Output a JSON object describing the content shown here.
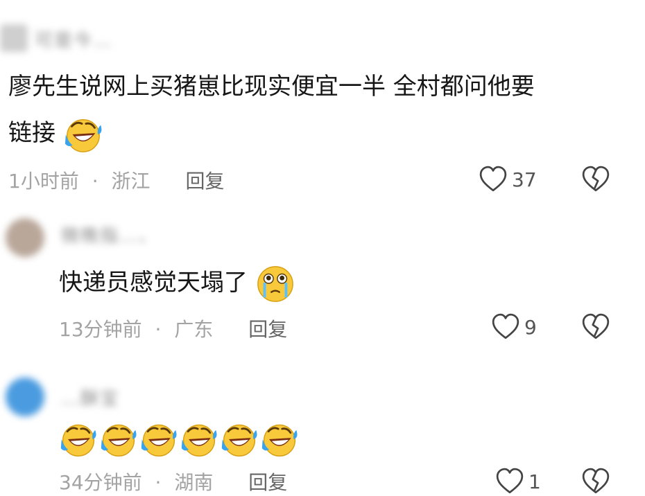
{
  "comments": [
    {
      "username": "可是今…",
      "text": "廖先生说网上买猪崽比现实便宜一半 全村都问他要",
      "text_line2": "链接",
      "emoji": "rolling-laugh",
      "time": "1小时前",
      "location": "浙江",
      "reply_label": "回复",
      "likes": "37"
    },
    {
      "username": "微晚指…、",
      "text": "快递员感觉天塌了",
      "emoji": "crying-face",
      "time": "13分钟前",
      "location": "广东",
      "reply_label": "回复",
      "likes": "9"
    },
    {
      "username": "…酥宝",
      "text": "",
      "emoji": "rolling-laugh",
      "emoji_repeat": 6,
      "time": "34分钟前",
      "location": "湖南",
      "reply_label": "回复",
      "likes": "1"
    }
  ],
  "separator": "·",
  "icons": [
    "heart-outline-icon",
    "broken-heart-icon"
  ],
  "colors": {
    "text": "#161616",
    "meta": "#a3a3a3",
    "emoji_face": "#f8c93a"
  }
}
